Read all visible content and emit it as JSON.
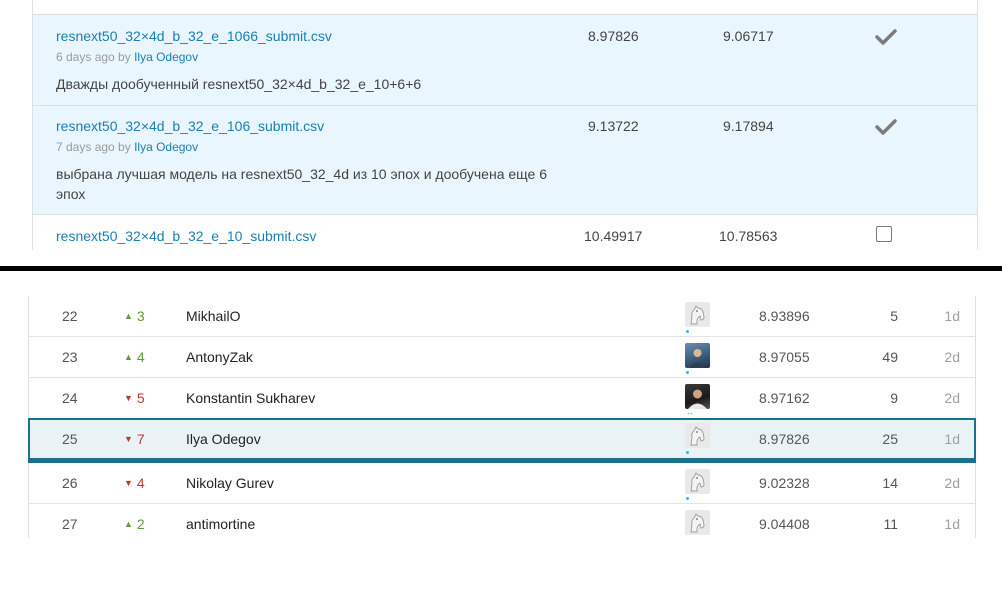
{
  "submissions": [
    {
      "file": "resnext50_32×4d_b_32_e_1066_submit.csv",
      "ago": "6 days ago by",
      "author": "Ilya Odegov",
      "description": "Дважды дообученный resnext50_32×4d_b_32_e_10+6+6",
      "private_score": "8.97826",
      "public_score": "9.06717",
      "selected": true
    },
    {
      "file": "resnext50_32×4d_b_32_e_106_submit.csv",
      "ago": "7 days ago by",
      "author": "Ilya Odegov",
      "description": "выбрана лучшая модель на resnext50_32_4d из 10 эпох и дообучена еще 6 эпох",
      "private_score": "9.13722",
      "public_score": "9.17894",
      "selected": true
    },
    {
      "file": "resnext50_32×4d_b_32_e_10_submit.csv",
      "private_score": "10.49917",
      "public_score": "10.78563",
      "selected": false
    }
  ],
  "leaderboard": [
    {
      "rank": "22",
      "direction": "up",
      "delta": "3",
      "name": "MikhailO",
      "avatar": "horse-avatar",
      "score": "8.93896",
      "entries": "5",
      "last": "1d"
    },
    {
      "rank": "23",
      "direction": "up",
      "delta": "4",
      "name": "AntonyZak",
      "avatar": "photo-avatar",
      "score": "8.97055",
      "entries": "49",
      "last": "2d"
    },
    {
      "rank": "24",
      "direction": "down",
      "delta": "5",
      "name": "Konstantin Sukharev",
      "avatar": "photo-avatar",
      "score": "8.97162",
      "entries": "9",
      "last": "2d"
    },
    {
      "rank": "25",
      "direction": "down",
      "delta": "7",
      "name": "Ilya Odegov",
      "avatar": "horse-avatar",
      "score": "8.97826",
      "entries": "25",
      "last": "1d",
      "current_user": true
    },
    {
      "rank": "26",
      "direction": "down",
      "delta": "4",
      "name": "Nikolay Gurev",
      "avatar": "horse-avatar",
      "score": "9.02328",
      "entries": "14",
      "last": "2d"
    },
    {
      "rank": "27",
      "direction": "up",
      "delta": "2",
      "name": "antimortine",
      "avatar": "horse-avatar",
      "score": "9.04408",
      "entries": "11",
      "last": "1d"
    }
  ],
  "colors": {
    "link": "#1a7fb5",
    "highlight_row": "#eaf6fd",
    "current_user_border": "#18718d",
    "rank_up": "#5a9e35",
    "rank_down": "#c0392b",
    "divider": "#000000"
  }
}
